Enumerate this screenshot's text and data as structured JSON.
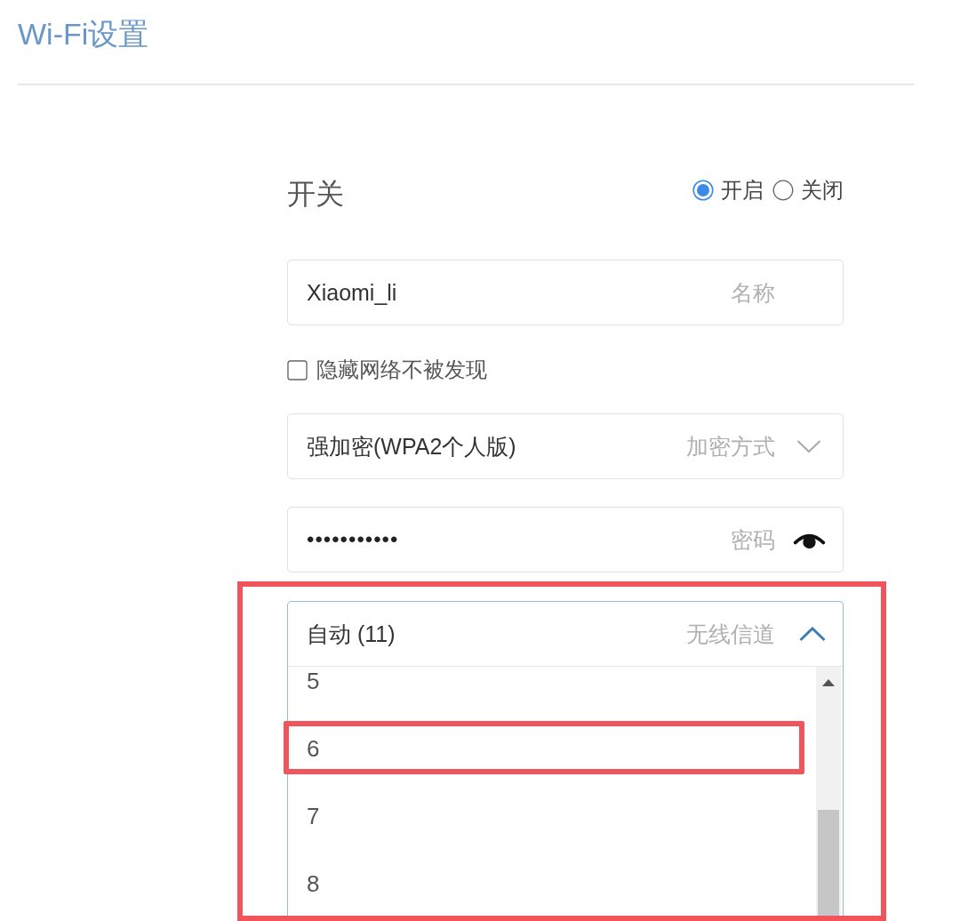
{
  "page": {
    "title": "Wi-Fi设置"
  },
  "switch": {
    "label": "开关",
    "options": [
      {
        "label": "开启",
        "selected": true
      },
      {
        "label": "关闭",
        "selected": false
      }
    ]
  },
  "fields": [
    {
      "kind": "text",
      "value": "Xiaomi_li",
      "caption": "名称"
    },
    {
      "kind": "checkbox",
      "label": "隐藏网络不被发现",
      "checked": false
    },
    {
      "kind": "select",
      "value": "强加密(WPA2个人版)",
      "caption": "加密方式",
      "expanded": false
    },
    {
      "kind": "password",
      "value": "•••••••••••",
      "caption": "密码"
    },
    {
      "kind": "select",
      "value": "自动 (11)",
      "caption": "无线信道",
      "expanded": true,
      "highlighted": true,
      "options": [
        {
          "label": "5",
          "highlighted": false
        },
        {
          "label": "6",
          "highlighted": true
        },
        {
          "label": "7",
          "highlighted": false
        },
        {
          "label": "8",
          "highlighted": false
        }
      ]
    }
  ]
}
